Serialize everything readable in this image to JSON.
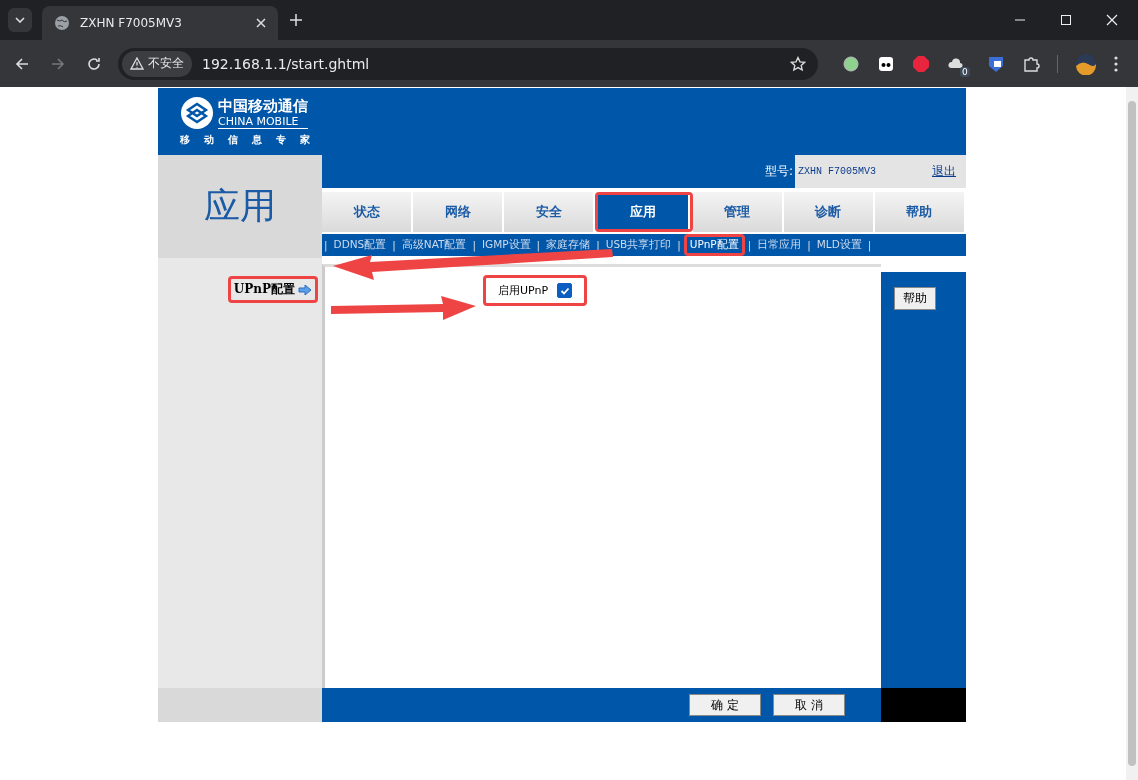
{
  "browser": {
    "tab_title": "ZXHN F7005MV3",
    "security_label": "不安全",
    "url": "192.168.1.1/start.ghtml",
    "extension_badge": "0"
  },
  "header": {
    "logo_cn": "中国移动通信",
    "logo_en": "CHINA MOBILE",
    "logo_slogan": [
      "移",
      "动",
      "信",
      "息",
      "专",
      "家"
    ]
  },
  "section_title": "应用",
  "model": {
    "label": "型号:",
    "value": "ZXHN F7005MV3",
    "logout": "退出"
  },
  "tabs": [
    {
      "label": "状态",
      "selected": false
    },
    {
      "label": "网络",
      "selected": false
    },
    {
      "label": "安全",
      "selected": false
    },
    {
      "label": "应用",
      "selected": true
    },
    {
      "label": "管理",
      "selected": false
    },
    {
      "label": "诊断",
      "selected": false
    },
    {
      "label": "帮助",
      "selected": false
    }
  ],
  "subnav_separator": "|",
  "subnav": [
    {
      "label": "DDNS配置",
      "selected": false
    },
    {
      "label": "高级NAT配置",
      "selected": false
    },
    {
      "label": "IGMP设置",
      "selected": false
    },
    {
      "label": "家庭存储",
      "selected": false
    },
    {
      "label": "USB共享打印",
      "selected": false
    },
    {
      "label": "UPnP配置",
      "selected": true
    },
    {
      "label": "日常应用",
      "selected": false
    },
    {
      "label": "MLD设置",
      "selected": false
    }
  ],
  "sidebar": {
    "items": [
      {
        "label": "UPnP配置",
        "selected": true
      }
    ]
  },
  "form": {
    "enable_upnp": {
      "label": "启用UPnP",
      "checked": true
    }
  },
  "help_button": "帮助",
  "buttons": [
    "确 定",
    "取 消"
  ]
}
